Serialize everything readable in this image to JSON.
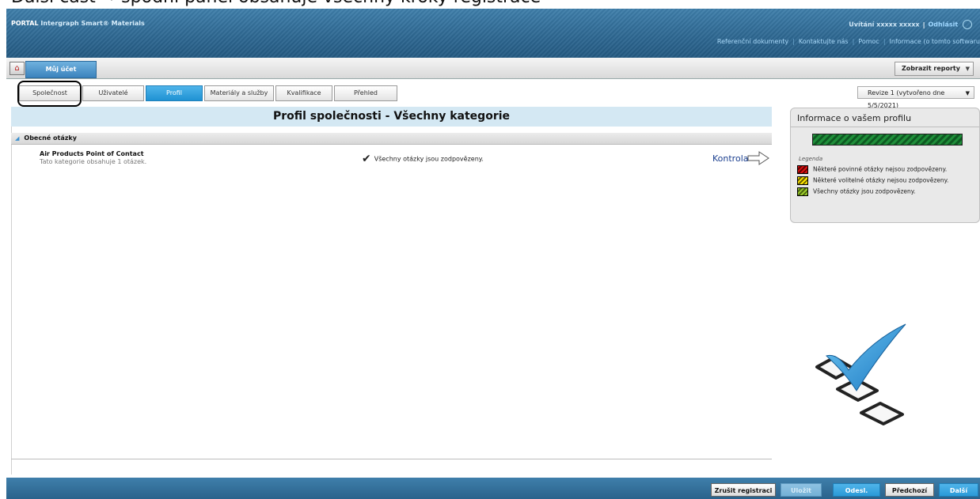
{
  "caption_fragment": "Další část → spodní panel obsahuje všechny kroky registrace",
  "header": {
    "portal": "PORTAL",
    "app_name": "Intergraph Smart® Materials",
    "welcome": "Uvítání xxxxx xxxxx",
    "separator": "|",
    "logout": "Odhlásit",
    "links": [
      "Referenční dokumenty",
      "Kontaktujte nás",
      "Pomoc",
      "Informace (o tomto softwaru"
    ]
  },
  "tabbar": {
    "my_account": "Můj účet",
    "reports": "Zobrazit reporty"
  },
  "steps": [
    "Společnost",
    "Uživatelé",
    "Profil",
    "Materiály a služby",
    "Kvalifikace",
    "Přehled"
  ],
  "active_step": "Profil",
  "revision": "Revize 1 (vytvořeno dne 5/5/2021)",
  "main": {
    "title": "Profil společnosti - Všechny kategorie",
    "group": "Obecné otázky",
    "category_title": "Air Products Point of Contact",
    "category_subtitle": "Tato kategorie obsahuje 1 otázek.",
    "status": "Všechny otázky jsou zodpovězeny.",
    "review": "Kontrola"
  },
  "info_panel": {
    "title": "Informace o vašem profilu",
    "progress_fraction": 1.0,
    "legend_title": "Legenda",
    "legend": [
      {
        "color": "red",
        "label": "Některé povinné otázky nejsou zodpovězeny."
      },
      {
        "color": "yellow",
        "label": "Některé volitelné otázky nejsou zodpovězeny."
      },
      {
        "color": "green",
        "label": "Všechny otázky jsou zodpovězeny."
      }
    ]
  },
  "footer": {
    "cancel_registration": "Zrušit registraci",
    "save": "Uložit",
    "submit": "Odesl.",
    "previous": "Předchozí",
    "next": "Další"
  },
  "colors": {
    "header_blue": "#2d6791",
    "active_step": "#1f92d3",
    "title_bar": "#d4e8f3",
    "link": "#1b3f8f"
  }
}
